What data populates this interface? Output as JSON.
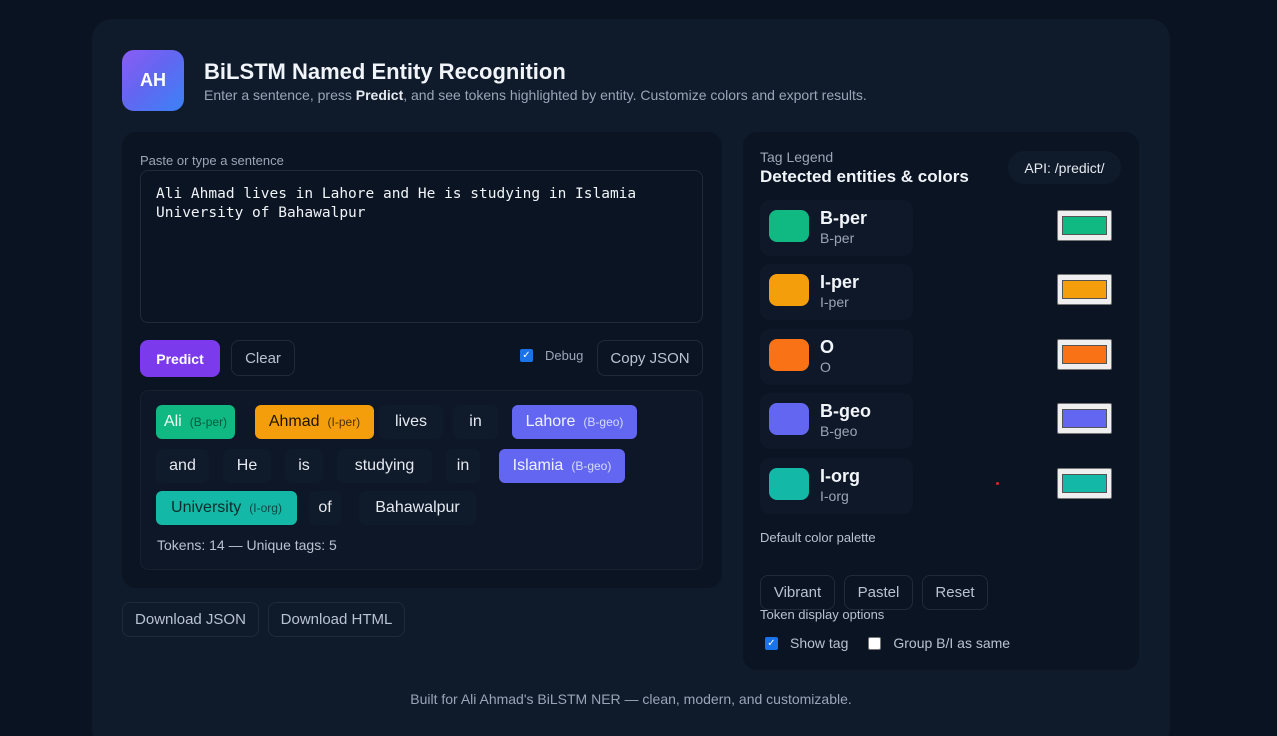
{
  "header": {
    "logo_initials": "AH",
    "title": "BiLSTM Named Entity Recognition",
    "subtitle_before": "Enter a sentence, press ",
    "subtitle_bold": "Predict",
    "subtitle_after": ", and see tokens highlighted by entity. Customize colors and export results."
  },
  "input": {
    "label": "Paste or type a sentence",
    "value": "Ali Ahmad lives in Lahore and He is studying in Islamia University of Bahawalpur"
  },
  "actions": {
    "predict_label": "Predict",
    "clear_label": "Clear",
    "debug_label": "Debug",
    "debug_checked": true,
    "copy_json_label": "Copy JSON"
  },
  "tokens": [
    {
      "text": "Ali",
      "tag": "(B-per)",
      "class": "bper"
    },
    {
      "text": "Ahmad",
      "tag": "(I-per)",
      "class": "iper"
    },
    {
      "text": "lives",
      "tag": "",
      "class": ""
    },
    {
      "text": "in",
      "tag": "",
      "class": ""
    },
    {
      "text": "Lahore",
      "tag": "(B-geo)",
      "class": "bgeo"
    },
    {
      "text": "and",
      "tag": "",
      "class": ""
    },
    {
      "text": "He",
      "tag": "",
      "class": ""
    },
    {
      "text": "is",
      "tag": "",
      "class": ""
    },
    {
      "text": "studying",
      "tag": "",
      "class": ""
    },
    {
      "text": "in",
      "tag": "",
      "class": ""
    },
    {
      "text": "Islamia",
      "tag": "(B-geo)",
      "class": "bgeo"
    },
    {
      "text": "University",
      "tag": "(I-org)",
      "class": "iorg"
    },
    {
      "text": "of",
      "tag": "",
      "class": ""
    },
    {
      "text": "Bahawalpur",
      "tag": "",
      "class": ""
    }
  ],
  "summary": "Tokens: 14 — Unique tags: 5",
  "downloads": {
    "json_label": "Download JSON",
    "html_label": "Download HTML"
  },
  "legend": {
    "small_label": "Tag Legend",
    "title": "Detected entities & colors",
    "api_label": "API: /predict/",
    "items": [
      {
        "name": "B-per",
        "sub": "B-per",
        "color": "#10b981"
      },
      {
        "name": "I-per",
        "sub": "I-per",
        "color": "#f59e0b"
      },
      {
        "name": "O",
        "sub": "O",
        "color": "#f97316"
      },
      {
        "name": "B-geo",
        "sub": "B-geo",
        "color": "#6366f1"
      },
      {
        "name": "I-org",
        "sub": "I-org",
        "color": "#14b8a6"
      }
    ]
  },
  "palette": {
    "label": "Default color palette",
    "vibrant_label": "Vibrant",
    "pastel_label": "Pastel",
    "reset_label": "Reset"
  },
  "display_options": {
    "label": "Token display options",
    "show_tag_label": "Show tag",
    "show_tag_checked": true,
    "group_label": "Group B/I as same",
    "group_checked": false
  },
  "footer": "Built for Ali Ahmad's BiLSTM NER — clean, modern, and customizable."
}
